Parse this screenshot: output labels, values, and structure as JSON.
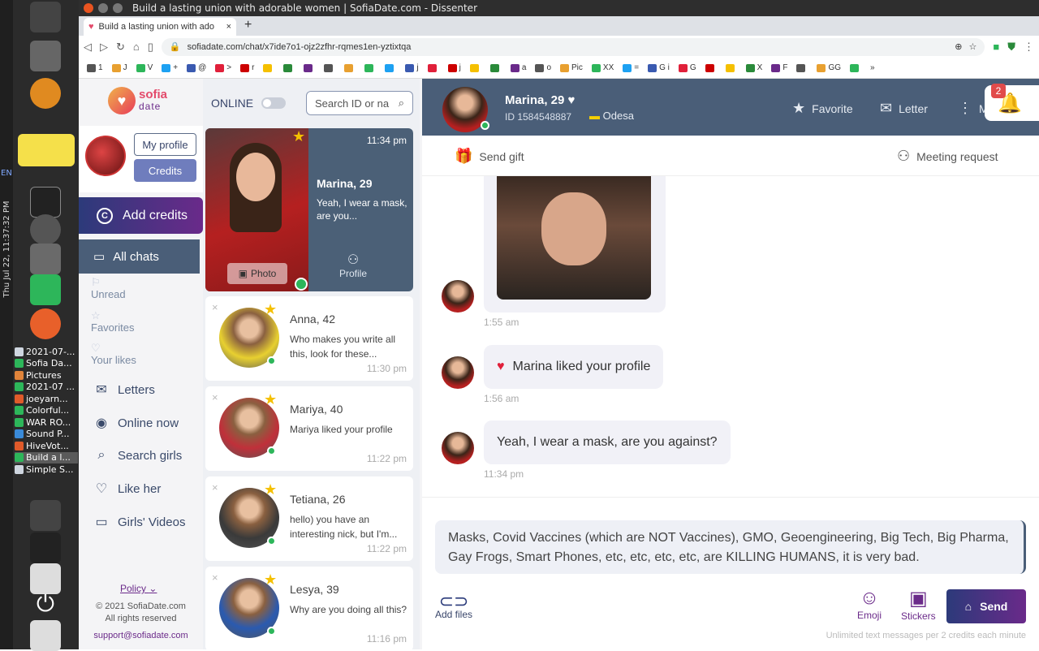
{
  "dock": {
    "clock": "Thu Jul 22, 11:37:32 PM",
    "lang": "EN",
    "tasks": [
      {
        "label": "2021-07-...",
        "color": "#cfd6e0"
      },
      {
        "label": "Sofia Da...",
        "color": "#2db65a"
      },
      {
        "label": "Pictures",
        "color": "#e0843a"
      },
      {
        "label": "2021-07 ...",
        "color": "#2db65a"
      },
      {
        "label": "joeyarn...",
        "color": "#e05a2a"
      },
      {
        "label": "Colorful...",
        "color": "#2db65a"
      },
      {
        "label": "WAR RO...",
        "color": "#2db65a"
      },
      {
        "label": "Sound P...",
        "color": "#3a8ad8"
      },
      {
        "label": "HiveVot...",
        "color": "#e05a2a"
      },
      {
        "label": "Build a l...",
        "color": "#2db65a"
      },
      {
        "label": "Simple S...",
        "color": "#cfd6e0"
      }
    ]
  },
  "browser": {
    "window_title": "Build a lasting union with adorable women | SofiaDate.com - Dissenter",
    "tab_title": "Build a lasting union with ado",
    "url": "sofiadate.com/chat/x7ide7o1-ojz2zfhr-rqmes1en-yztixtqa",
    "bookmarks": [
      "1",
      "J",
      "V",
      "+",
      "@",
      ">",
      "r",
      "",
      "",
      "",
      "",
      "",
      "",
      "",
      "j",
      "",
      "j",
      "",
      "",
      "a",
      "o",
      "Pic",
      "XX",
      "=",
      "G i",
      "G",
      "",
      "",
      "X",
      "F",
      "",
      "GG",
      "",
      "»"
    ]
  },
  "brand": {
    "name_top": "sofia",
    "name_bottom": "date"
  },
  "profile": {
    "my_profile": "My profile",
    "credits": "Credits"
  },
  "nav": {
    "add_credits": "Add credits",
    "all_chats": "All chats",
    "unread": "Unread",
    "favorites": "Favorites",
    "your_likes": "Your likes",
    "letters": "Letters",
    "online_now": "Online now",
    "search_girls": "Search girls",
    "like_her": "Like her",
    "girls_videos": "Girls' Videos",
    "policy": "Policy",
    "copyright": "© 2021 SofiaDate.com",
    "rights": "All rights reserved",
    "support": "support@sofiadate.com"
  },
  "chatlist": {
    "online_label": "ONLINE",
    "search_placeholder": "Search ID or na",
    "active": {
      "time": "11:34 pm",
      "name": "Marina, 29",
      "message": "Yeah, I wear a mask, are you...",
      "photo_label": "Photo",
      "profile_label": "Profile"
    },
    "items": [
      {
        "name": "Anna, 42",
        "message": "Who makes you write all this, look for these...",
        "time": "11:30 pm",
        "color": "#e8d030"
      },
      {
        "name": "Mariya, 40",
        "message": "Mariya liked your profile",
        "time": "11:22 pm",
        "color": "#c0303a"
      },
      {
        "name": "Tetiana, 26",
        "message": "hello) you have an interesting nick, but I'm...",
        "time": "11:22 pm",
        "color": "#3a3a3a"
      },
      {
        "name": "Lesya, 39",
        "message": "Why are you doing all this?",
        "time": "11:16 pm",
        "color": "#2a5ab0"
      }
    ]
  },
  "chat": {
    "name": "Marina, 29",
    "id": "ID 1584548887",
    "city": "Odesa",
    "favorite": "Favorite",
    "letter": "Letter",
    "more": "M",
    "notifications": "2",
    "send_gift": "Send gift",
    "meeting_request": "Meeting request",
    "messages": [
      {
        "time": "1:55 am"
      },
      {
        "text": "Marina liked your profile",
        "time": "1:56 am"
      },
      {
        "text": "Yeah, I wear a mask, are you against?",
        "time": "11:34 pm"
      }
    ],
    "draft": "Masks, Covid Vaccines (which are NOT Vaccines), GMO, Geoengineering, Big Tech, Big Pharma, Gay Frogs, Smart Phones, etc, etc, etc, etc, are KILLING HUMANS, it is very bad.",
    "add_files": "Add files",
    "emoji": "Emoji",
    "stickers": "Stickers",
    "send": "Send",
    "note": "Unlimited text messages per 2 credits each minute"
  }
}
